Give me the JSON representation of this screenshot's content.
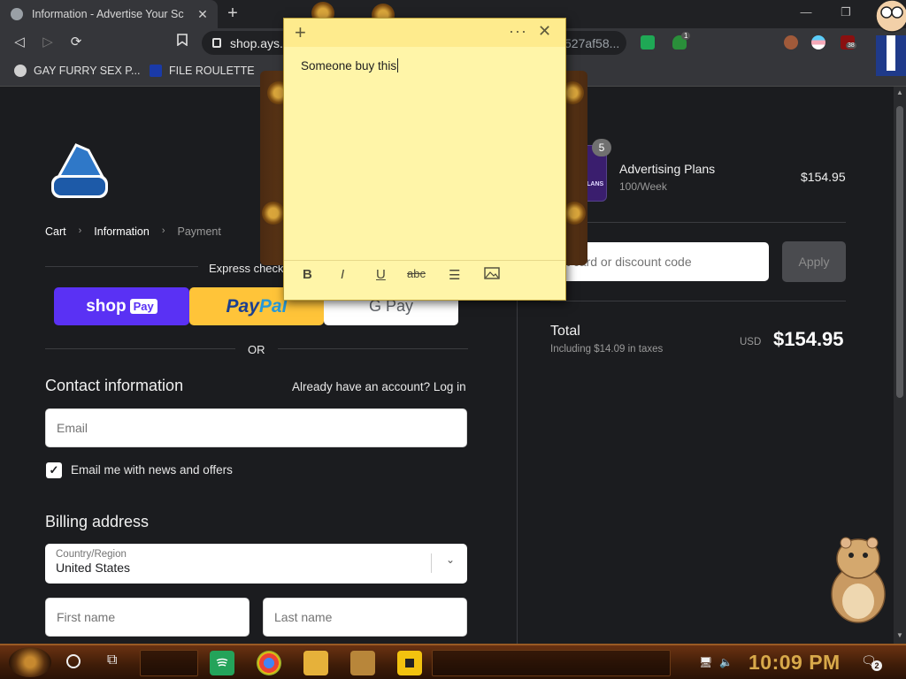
{
  "browser": {
    "tab_title": "Information - Advertise Your Sc",
    "url_visible": "shop.ays.",
    "url_tail": "527af58...",
    "ext_count_badge": "1",
    "ext_count_badge2": "38",
    "bookmarks": [
      {
        "label": "GAY FURRY SEX P..."
      },
      {
        "label": "FILE ROULETTE"
      }
    ]
  },
  "checkout": {
    "breadcrumbs": [
      "Cart",
      "Information",
      "Payment"
    ],
    "express_label": "Express check",
    "buttons": {
      "shop": "shop",
      "shop_pill": "Pay",
      "paypal_a": "Pay",
      "paypal_b": "Pal",
      "gpay": "G Pay"
    },
    "or_label": "OR",
    "contact_title": "Contact information",
    "account_prompt": "Already have an account? Log in",
    "email_placeholder": "Email",
    "newsletter_label": "Email me with news and offers",
    "newsletter_checked": true,
    "billing_title": "Billing address",
    "country_label": "Country/Region",
    "country_value": "United States",
    "first_name_placeholder": "First name",
    "last_name_placeholder": "Last name"
  },
  "summary": {
    "item_quantity": "5",
    "item_name": "Advertising Plans",
    "item_variant": "100/Week",
    "item_price": "$154.95",
    "thumb_text": "TISING LANS",
    "discount_placeholder": "t card or discount code",
    "apply_label": "Apply",
    "total_label": "Total",
    "tax_note": "Including $14.09 in taxes",
    "currency": "USD",
    "total_value": "$154.95"
  },
  "sticky_note": {
    "text": "Someone buy this"
  },
  "taskbar": {
    "clock": "10:09 PM",
    "notification_count": "2"
  },
  "colors": {
    "page_bg": "#1b1c1f",
    "shop_pay": "#5a31f4",
    "paypal": "#ffc439",
    "note_bg": "#fff5a8",
    "clock": "#d8a94a"
  }
}
